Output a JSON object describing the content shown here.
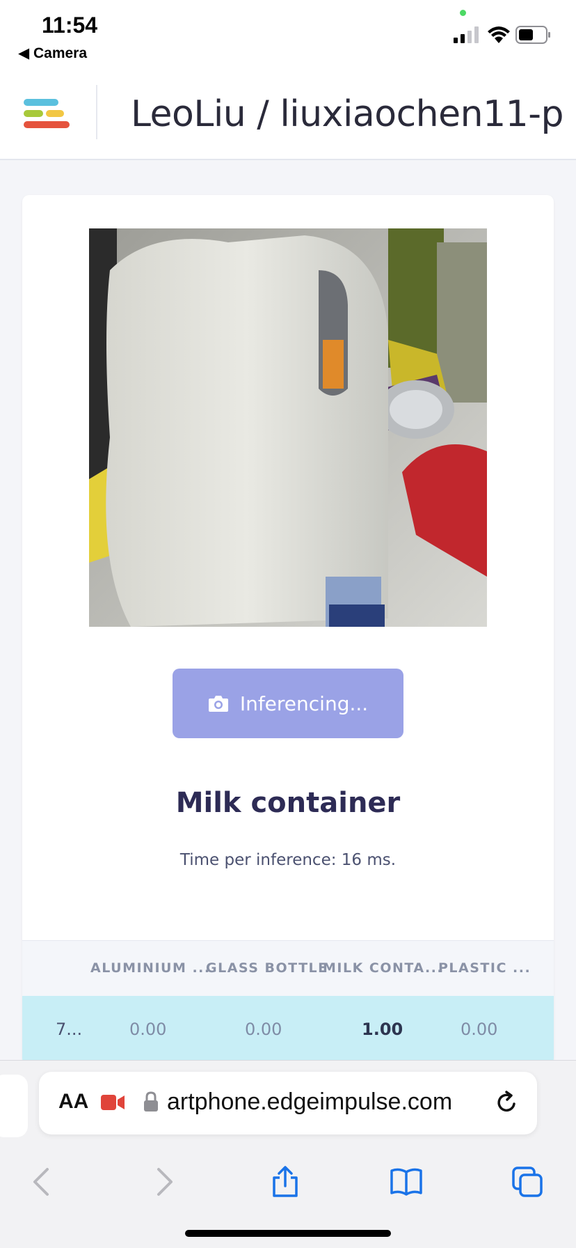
{
  "status_bar": {
    "time": "11:54",
    "back_app": "◀ Camera"
  },
  "header": {
    "project_title": "LeoLiu / liuxiaochen11-p..."
  },
  "classifier": {
    "button_label": "Inferencing...",
    "result_label": "Milk container",
    "inference_time": "Time per inference: 16 ms.",
    "table": {
      "headers": [
        "",
        "ALUMINIUM ...",
        "GLASS BOTTLE",
        "MILK CONTA...",
        "PLASTIC ..."
      ],
      "row": [
        "7...",
        "0.00",
        "0.00",
        "1.00",
        "0.00"
      ]
    }
  },
  "browser": {
    "text_size_label": "AA",
    "url": "artphone.edgeimpulse.com"
  },
  "colors": {
    "button": "#9aa2e6",
    "row_highlight": "#c8eef6",
    "title_text": "#2d2b55"
  }
}
